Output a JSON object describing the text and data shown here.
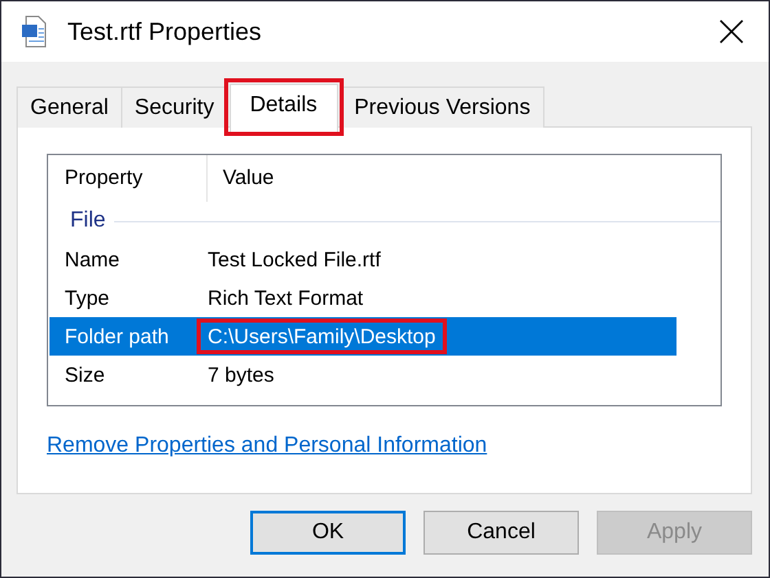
{
  "window": {
    "title": "Test.rtf Properties"
  },
  "tabs": [
    {
      "label": "General",
      "selected": false,
      "highlighted": false
    },
    {
      "label": "Security",
      "selected": false,
      "highlighted": false
    },
    {
      "label": "Details",
      "selected": true,
      "highlighted": true
    },
    {
      "label": "Previous Versions",
      "selected": false,
      "highlighted": false
    }
  ],
  "table": {
    "columns": [
      "Property",
      "Value"
    ],
    "groups": [
      {
        "label": "File",
        "rows": [
          {
            "property": "Name",
            "value": "Test Locked File.rtf",
            "selected": false,
            "highlighted": false
          },
          {
            "property": "Type",
            "value": "Rich Text Format",
            "selected": false,
            "highlighted": false
          },
          {
            "property": "Folder path",
            "value": "C:\\Users\\Family\\Desktop",
            "selected": true,
            "highlighted": true
          },
          {
            "property": "Size",
            "value": "7 bytes",
            "selected": false,
            "highlighted": false
          }
        ]
      }
    ]
  },
  "link": "Remove Properties and Personal Information",
  "buttons": [
    {
      "label": "OK",
      "default": true,
      "disabled": false
    },
    {
      "label": "Cancel",
      "default": false,
      "disabled": false
    },
    {
      "label": "Apply",
      "default": false,
      "disabled": true
    }
  ]
}
